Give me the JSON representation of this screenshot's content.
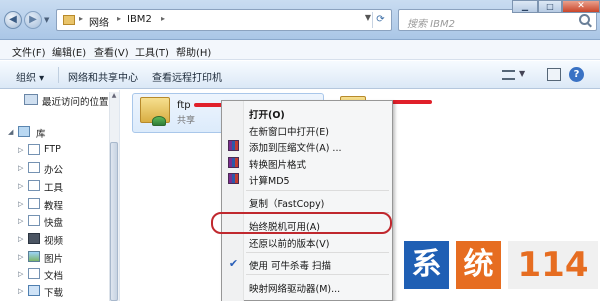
{
  "titlebar": {
    "address": [
      "网络",
      "IBM2"
    ],
    "search_placeholder": "搜索 IBM2"
  },
  "menubar": {
    "items": [
      "文件(F)",
      "编辑(E)",
      "查看(V)",
      "工具(T)",
      "帮助(H)"
    ]
  },
  "toolbar": {
    "items": [
      "组织 ▾",
      "网络和共享中心",
      "查看远程打印机"
    ]
  },
  "nav": {
    "recent": "最近访问的位置",
    "library": "库",
    "items": [
      "FTP",
      "办公",
      "工具",
      "教程",
      "快盘",
      "视频",
      "图片",
      "文档",
      "下载"
    ]
  },
  "content": {
    "item_name": "ftp",
    "item_type": "共享"
  },
  "context_menu": {
    "items": [
      {
        "label": "打开(O)",
        "bold": true
      },
      {
        "label": "在新窗口中打开(E)"
      },
      {
        "label": "添加到压缩文件(A) ..."
      },
      {
        "label": "转换图片格式"
      },
      {
        "label": "计算MD5"
      },
      {
        "label": "复制（FastCopy)"
      },
      {
        "label": "始终脱机可用(A)"
      },
      {
        "label": "还原以前的版本(V)"
      },
      {
        "label": "使用 可牛杀毒 扫描"
      },
      {
        "label": "映射网络驱动器(M)..."
      }
    ],
    "highlighted": "始终脱机可用(A)"
  },
  "watermark": {
    "chars": [
      "系",
      "统",
      "114"
    ]
  },
  "colors": {
    "accent": "#1f5fb4",
    "highlight_ring": "#c0282e",
    "redaction": "#e0202a",
    "watermark_orange": "#e66d21"
  }
}
